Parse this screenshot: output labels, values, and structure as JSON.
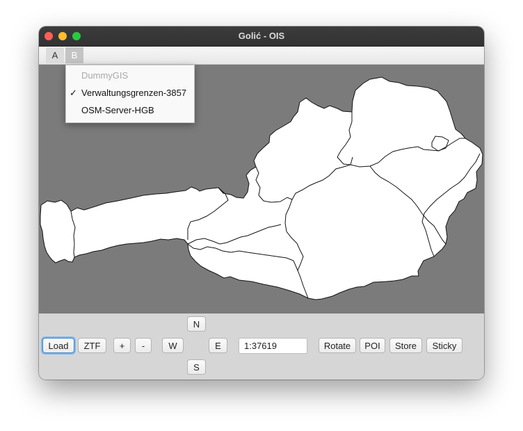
{
  "window": {
    "title": "Golić - OIS"
  },
  "menubar": {
    "items": [
      "A",
      "B"
    ]
  },
  "dropdown": {
    "items": [
      {
        "label": "DummyGIS",
        "enabled": false,
        "checked": false
      },
      {
        "label": "Verwaltungsgrenzen-3857",
        "enabled": true,
        "checked": true
      },
      {
        "label": "OSM-Server-HGB",
        "enabled": true,
        "checked": false
      }
    ],
    "check_glyph": "✓"
  },
  "controls": {
    "load": "Load",
    "ztf": "ZTF",
    "zoom_in": "+",
    "zoom_out": "-",
    "north": "N",
    "south": "S",
    "west": "W",
    "east": "E",
    "scale_value": "1:37619",
    "rotate": "Rotate",
    "poi": "POI",
    "store": "Store",
    "sticky": "Sticky"
  },
  "colors": {
    "map_background": "#7b7b7b",
    "map_fill": "#ffffff",
    "border_stroke": "#000000",
    "focus_accent": "#3b86cf"
  }
}
